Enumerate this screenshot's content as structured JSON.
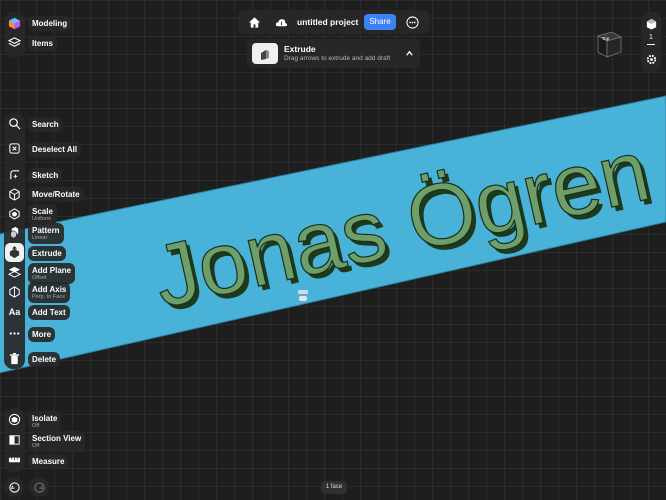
{
  "workspace": {
    "modeling_label": "Modeling",
    "items_label": "Items"
  },
  "topbar": {
    "project_title": "untitled project",
    "share_label": "Share"
  },
  "hint": {
    "title": "Extrude",
    "description": "Drag arrows to extrude and add draft"
  },
  "tools": {
    "search": "Search",
    "deselect_all": "Deselect All",
    "sketch": "Sketch",
    "move_rotate": "Move/Rotate",
    "scale": "Scale",
    "scale_sub": "Uniform",
    "pattern": "Pattern",
    "pattern_sub": "Linear",
    "extrude": "Extrude",
    "add_plane": "Add Plane",
    "add_plane_sub": "Offset",
    "add_axis": "Add Axis",
    "add_axis_sub": "Perp. to Face",
    "add_text": "Add Text",
    "add_text_icon": "Aa",
    "more": "More",
    "delete": "Delete"
  },
  "view_tools": {
    "isolate": "Isolate",
    "isolate_sub": "Off",
    "section_view": "Section View",
    "section_view_sub": "Off",
    "measure": "Measure"
  },
  "right_rail": {
    "cube_face": "Top",
    "count": "1"
  },
  "scene": {
    "text": "Jonas Ögren"
  },
  "status": {
    "selection": "1 face"
  },
  "colors": {
    "accent": "#3b82f6",
    "plate": "#48b2d8",
    "text_face": "#6e9e6a",
    "text_side": "#1e3a1c",
    "background": "#1e1e1e"
  }
}
